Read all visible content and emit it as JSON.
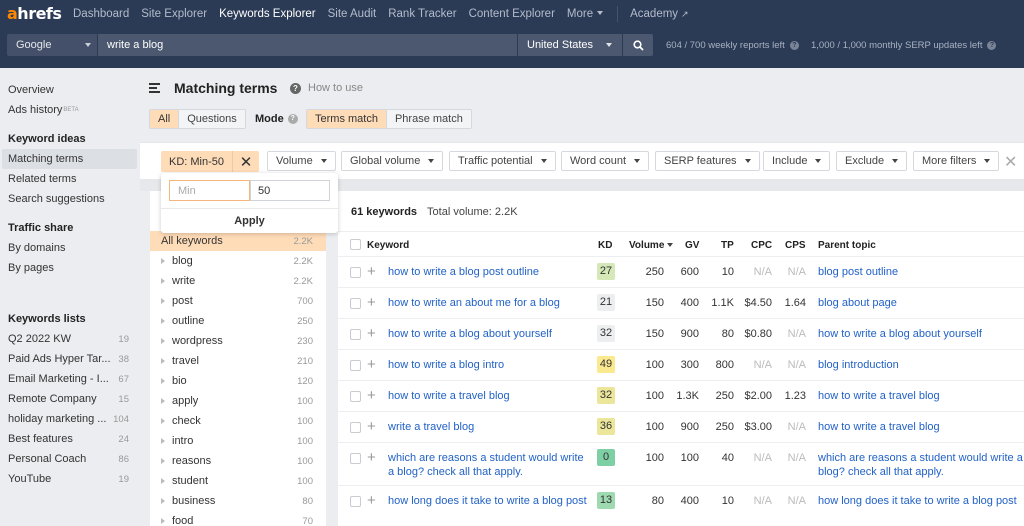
{
  "nav": {
    "logo_accent": "a",
    "logo_rest": "hrefs",
    "links": [
      {
        "label": "Dashboard",
        "active": false
      },
      {
        "label": "Site Explorer",
        "active": false
      },
      {
        "label": "Keywords Explorer",
        "active": true
      },
      {
        "label": "Site Audit",
        "active": false
      },
      {
        "label": "Rank Tracker",
        "active": false
      },
      {
        "label": "Content Explorer",
        "active": false
      }
    ],
    "more_label": "More",
    "academy_label": "Academy",
    "external_icon": "↗"
  },
  "search": {
    "engine": "Google",
    "query": "write a blog",
    "country": "United States",
    "search_icon": "magnifier",
    "weekly_quota": "604 / 700 weekly reports left",
    "monthly_quota": "1,000 / 1,000 monthly SERP updates left"
  },
  "sidebar": {
    "overview": "Overview",
    "ads_history": "Ads history",
    "beta": "BETA",
    "keyword_ideas_heading": "Keyword ideas",
    "keyword_ideas": [
      "Matching terms",
      "Related terms",
      "Search suggestions"
    ],
    "active_item": "Matching terms",
    "traffic_share_heading": "Traffic share",
    "traffic_share": [
      "By domains",
      "By pages"
    ],
    "lists_heading": "Keywords lists",
    "lists": [
      {
        "name": "Q2 2022 KW",
        "count": "19"
      },
      {
        "name": "Paid Ads Hyper Tar...",
        "count": "38"
      },
      {
        "name": "Email Marketing - I...",
        "count": "67"
      },
      {
        "name": "Remote Company",
        "count": "15"
      },
      {
        "name": "holiday marketing ...",
        "count": "104"
      },
      {
        "name": "Best features",
        "count": "24"
      },
      {
        "name": "Personal Coach",
        "count": "86"
      },
      {
        "name": "YouTube",
        "count": "19"
      }
    ]
  },
  "header": {
    "title": "Matching terms",
    "help_icon": "?",
    "how_to_use": "How to use",
    "scope_tabs": [
      {
        "label": "All",
        "active": true
      },
      {
        "label": "Questions",
        "active": false
      }
    ],
    "mode_label": "Mode",
    "mode_tabs": [
      {
        "label": "Terms match",
        "active": true
      },
      {
        "label": "Phrase match",
        "active": false
      }
    ]
  },
  "filters": {
    "kd_active": "KD: Min-50",
    "kd_clear": "✕",
    "buttons": [
      "Volume",
      "Global volume",
      "Traffic potential",
      "Word count",
      "SERP features",
      "Include",
      "Exclude",
      "More filters"
    ],
    "clear_all": "✕"
  },
  "kd_popover": {
    "min_placeholder": "Min",
    "max_value": "50",
    "apply_label": "Apply"
  },
  "words": [
    {
      "term": "All keywords",
      "value": "2.2K",
      "selected": true
    },
    {
      "term": "blog",
      "value": "2.2K"
    },
    {
      "term": "write",
      "value": "2.2K"
    },
    {
      "term": "post",
      "value": "700"
    },
    {
      "term": "outline",
      "value": "250"
    },
    {
      "term": "wordpress",
      "value": "230"
    },
    {
      "term": "travel",
      "value": "210"
    },
    {
      "term": "bio",
      "value": "120"
    },
    {
      "term": "apply",
      "value": "100"
    },
    {
      "term": "check",
      "value": "100"
    },
    {
      "term": "intro",
      "value": "100"
    },
    {
      "term": "reasons",
      "value": "100"
    },
    {
      "term": "student",
      "value": "100"
    },
    {
      "term": "business",
      "value": "80"
    },
    {
      "term": "food",
      "value": "70"
    }
  ],
  "results": {
    "count_label": "61 keywords",
    "total_volume": "Total volume: 2.2K",
    "columns": {
      "keyword": "Keyword",
      "kd": "KD",
      "volume": "Volume",
      "gv": "GV",
      "tp": "TP",
      "cpc": "CPC",
      "cps": "CPS",
      "parent": "Parent topic"
    },
    "kd_colors": {
      "low_green": "#9fd9b0",
      "green": "#d4e8b8",
      "grey": "#eceef0",
      "yellow_green": "#ece69a",
      "yellow": "#fbe98f",
      "teal": "#7fcfa5"
    },
    "rows": [
      {
        "keyword": "how to write a blog post outline",
        "kd": "27",
        "kd_color": "#d4e8b8",
        "volume": "250",
        "gv": "600",
        "tp": "10",
        "cpc": "N/A",
        "cps": "N/A",
        "parent": "blog post outline"
      },
      {
        "keyword": "how to write an about me for a blog",
        "kd": "21",
        "kd_color": "#eceef0",
        "volume": "150",
        "gv": "400",
        "tp": "1.1K",
        "cpc": "$4.50",
        "cps": "1.64",
        "parent": "blog about page"
      },
      {
        "keyword": "how to write a blog about yourself",
        "kd": "32",
        "kd_color": "#eceef0",
        "volume": "150",
        "gv": "900",
        "tp": "80",
        "cpc": "$0.80",
        "cps": "N/A",
        "parent": "how to write a blog about yourself"
      },
      {
        "keyword": "how to write a blog intro",
        "kd": "49",
        "kd_color": "#fbe98f",
        "volume": "100",
        "gv": "300",
        "tp": "800",
        "cpc": "N/A",
        "cps": "N/A",
        "parent": "blog introduction"
      },
      {
        "keyword": "how to write a travel blog",
        "kd": "32",
        "kd_color": "#ece69a",
        "volume": "100",
        "gv": "1.3K",
        "tp": "250",
        "cpc": "$2.00",
        "cps": "1.23",
        "parent": "how to write a travel blog"
      },
      {
        "keyword": "write a travel blog",
        "kd": "36",
        "kd_color": "#ece69a",
        "volume": "100",
        "gv": "900",
        "tp": "250",
        "cpc": "$3.00",
        "cps": "N/A",
        "parent": "how to write a travel blog"
      },
      {
        "keyword": "which are reasons a student would write a blog? check all that apply.",
        "kd": "0",
        "kd_color": "#7fcfa5",
        "volume": "100",
        "gv": "100",
        "tp": "40",
        "cpc": "N/A",
        "cps": "N/A",
        "parent": "which are reasons a student would write a blog? check all that apply."
      },
      {
        "keyword": "how long does it take to write a blog post",
        "kd": "13",
        "kd_color": "#9fd9b0",
        "volume": "80",
        "gv": "400",
        "tp": "10",
        "cpc": "N/A",
        "cps": "N/A",
        "parent": "how long does it take to write a blog post"
      }
    ]
  }
}
